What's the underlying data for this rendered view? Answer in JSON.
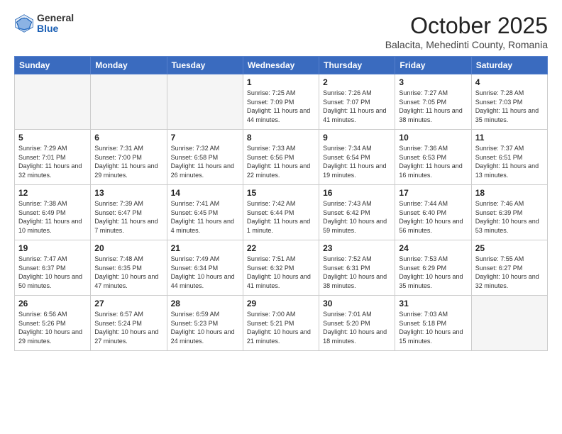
{
  "header": {
    "logo_general": "General",
    "logo_blue": "Blue",
    "month_title": "October 2025",
    "location": "Balacita, Mehedinti County, Romania"
  },
  "days_of_week": [
    "Sunday",
    "Monday",
    "Tuesday",
    "Wednesday",
    "Thursday",
    "Friday",
    "Saturday"
  ],
  "weeks": [
    [
      {
        "day": "",
        "detail": ""
      },
      {
        "day": "",
        "detail": ""
      },
      {
        "day": "",
        "detail": ""
      },
      {
        "day": "1",
        "detail": "Sunrise: 7:25 AM\nSunset: 7:09 PM\nDaylight: 11 hours\nand 44 minutes."
      },
      {
        "day": "2",
        "detail": "Sunrise: 7:26 AM\nSunset: 7:07 PM\nDaylight: 11 hours\nand 41 minutes."
      },
      {
        "day": "3",
        "detail": "Sunrise: 7:27 AM\nSunset: 7:05 PM\nDaylight: 11 hours\nand 38 minutes."
      },
      {
        "day": "4",
        "detail": "Sunrise: 7:28 AM\nSunset: 7:03 PM\nDaylight: 11 hours\nand 35 minutes."
      }
    ],
    [
      {
        "day": "5",
        "detail": "Sunrise: 7:29 AM\nSunset: 7:01 PM\nDaylight: 11 hours\nand 32 minutes."
      },
      {
        "day": "6",
        "detail": "Sunrise: 7:31 AM\nSunset: 7:00 PM\nDaylight: 11 hours\nand 29 minutes."
      },
      {
        "day": "7",
        "detail": "Sunrise: 7:32 AM\nSunset: 6:58 PM\nDaylight: 11 hours\nand 26 minutes."
      },
      {
        "day": "8",
        "detail": "Sunrise: 7:33 AM\nSunset: 6:56 PM\nDaylight: 11 hours\nand 22 minutes."
      },
      {
        "day": "9",
        "detail": "Sunrise: 7:34 AM\nSunset: 6:54 PM\nDaylight: 11 hours\nand 19 minutes."
      },
      {
        "day": "10",
        "detail": "Sunrise: 7:36 AM\nSunset: 6:53 PM\nDaylight: 11 hours\nand 16 minutes."
      },
      {
        "day": "11",
        "detail": "Sunrise: 7:37 AM\nSunset: 6:51 PM\nDaylight: 11 hours\nand 13 minutes."
      }
    ],
    [
      {
        "day": "12",
        "detail": "Sunrise: 7:38 AM\nSunset: 6:49 PM\nDaylight: 11 hours\nand 10 minutes."
      },
      {
        "day": "13",
        "detail": "Sunrise: 7:39 AM\nSunset: 6:47 PM\nDaylight: 11 hours\nand 7 minutes."
      },
      {
        "day": "14",
        "detail": "Sunrise: 7:41 AM\nSunset: 6:45 PM\nDaylight: 11 hours\nand 4 minutes."
      },
      {
        "day": "15",
        "detail": "Sunrise: 7:42 AM\nSunset: 6:44 PM\nDaylight: 11 hours\nand 1 minute."
      },
      {
        "day": "16",
        "detail": "Sunrise: 7:43 AM\nSunset: 6:42 PM\nDaylight: 10 hours\nand 59 minutes."
      },
      {
        "day": "17",
        "detail": "Sunrise: 7:44 AM\nSunset: 6:40 PM\nDaylight: 10 hours\nand 56 minutes."
      },
      {
        "day": "18",
        "detail": "Sunrise: 7:46 AM\nSunset: 6:39 PM\nDaylight: 10 hours\nand 53 minutes."
      }
    ],
    [
      {
        "day": "19",
        "detail": "Sunrise: 7:47 AM\nSunset: 6:37 PM\nDaylight: 10 hours\nand 50 minutes."
      },
      {
        "day": "20",
        "detail": "Sunrise: 7:48 AM\nSunset: 6:35 PM\nDaylight: 10 hours\nand 47 minutes."
      },
      {
        "day": "21",
        "detail": "Sunrise: 7:49 AM\nSunset: 6:34 PM\nDaylight: 10 hours\nand 44 minutes."
      },
      {
        "day": "22",
        "detail": "Sunrise: 7:51 AM\nSunset: 6:32 PM\nDaylight: 10 hours\nand 41 minutes."
      },
      {
        "day": "23",
        "detail": "Sunrise: 7:52 AM\nSunset: 6:31 PM\nDaylight: 10 hours\nand 38 minutes."
      },
      {
        "day": "24",
        "detail": "Sunrise: 7:53 AM\nSunset: 6:29 PM\nDaylight: 10 hours\nand 35 minutes."
      },
      {
        "day": "25",
        "detail": "Sunrise: 7:55 AM\nSunset: 6:27 PM\nDaylight: 10 hours\nand 32 minutes."
      }
    ],
    [
      {
        "day": "26",
        "detail": "Sunrise: 6:56 AM\nSunset: 5:26 PM\nDaylight: 10 hours\nand 29 minutes."
      },
      {
        "day": "27",
        "detail": "Sunrise: 6:57 AM\nSunset: 5:24 PM\nDaylight: 10 hours\nand 27 minutes."
      },
      {
        "day": "28",
        "detail": "Sunrise: 6:59 AM\nSunset: 5:23 PM\nDaylight: 10 hours\nand 24 minutes."
      },
      {
        "day": "29",
        "detail": "Sunrise: 7:00 AM\nSunset: 5:21 PM\nDaylight: 10 hours\nand 21 minutes."
      },
      {
        "day": "30",
        "detail": "Sunrise: 7:01 AM\nSunset: 5:20 PM\nDaylight: 10 hours\nand 18 minutes."
      },
      {
        "day": "31",
        "detail": "Sunrise: 7:03 AM\nSunset: 5:18 PM\nDaylight: 10 hours\nand 15 minutes."
      },
      {
        "day": "",
        "detail": ""
      }
    ]
  ]
}
